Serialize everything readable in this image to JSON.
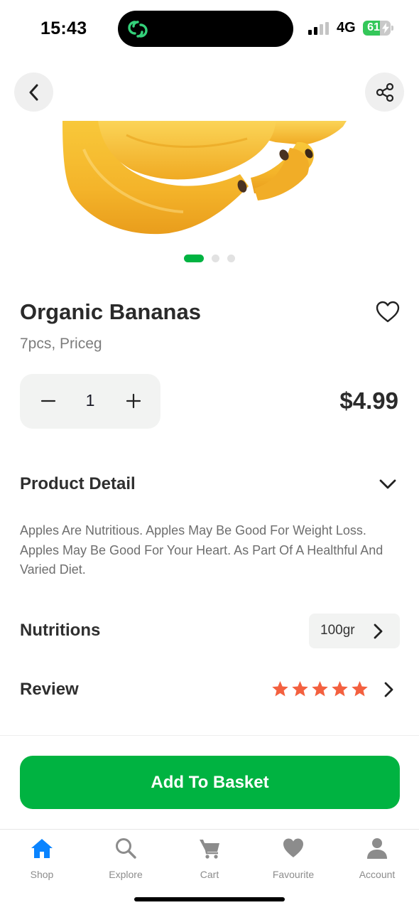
{
  "status_bar": {
    "time": "15:43",
    "network": "4G",
    "battery_level": "61",
    "battery_fraction": 0.61,
    "signal_icon": "signal-bars-icon",
    "app_indicator_icon": "link-loop-icon"
  },
  "nav": {
    "back_icon": "chevron-left-icon",
    "share_icon": "share-icon"
  },
  "carousel": {
    "total": 3,
    "active_index": 0
  },
  "product": {
    "name": "Organic Bananas",
    "subtitle": "7pcs, Priceg",
    "quantity": "1",
    "price": "$4.99",
    "favourite_icon": "heart-outline-icon",
    "minus_icon": "minus-icon",
    "plus_icon": "plus-icon"
  },
  "detail": {
    "title": "Product Detail",
    "toggle_icon": "chevron-down-icon",
    "description": "Apples Are Nutritious. Apples May Be Good For Weight Loss. Apples May Be Good For Your Heart. As Part Of A Healthful And Varied Diet."
  },
  "nutrition": {
    "title": "Nutritions",
    "value": "100gr",
    "arrow_icon": "chevron-right-icon"
  },
  "review": {
    "title": "Review",
    "rating": 5,
    "max_rating": 5,
    "star_color": "#f3603f",
    "arrow_icon": "chevron-right-icon"
  },
  "cta": {
    "label": "Add To Basket",
    "color": "#00b341"
  },
  "tabbar": {
    "active_color": "#0a84ff",
    "inactive_color": "#8c8c8c",
    "tabs": [
      {
        "label": "Shop",
        "icon": "home-icon",
        "active": true
      },
      {
        "label": "Explore",
        "icon": "search-icon",
        "active": false
      },
      {
        "label": "Cart",
        "icon": "cart-icon",
        "active": false
      },
      {
        "label": "Favourite",
        "icon": "heart-icon",
        "active": false
      },
      {
        "label": "Account",
        "icon": "person-icon",
        "active": false
      }
    ]
  }
}
